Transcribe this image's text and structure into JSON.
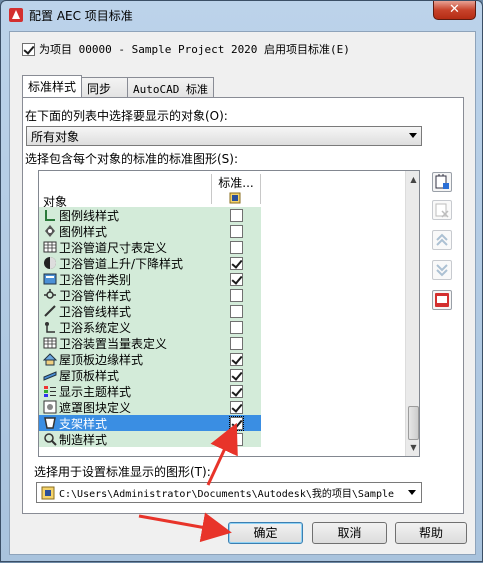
{
  "window": {
    "title": "配置 AEC 项目标准",
    "close": "✕"
  },
  "enable_checkbox": {
    "checked": true,
    "label": "为项目 00000 - Sample Project 2020 启用项目标准(E)"
  },
  "tabs": [
    {
      "label": "标准样式",
      "active": true
    },
    {
      "label": "同步",
      "active": false
    },
    {
      "label": "AutoCAD 标准",
      "active": false
    }
  ],
  "object_list_label": "在下面的列表中选择要显示的对象(O):",
  "object_combo_value": "所有对象",
  "standards_label": "选择包含每个对象的标准的标准图形(S):",
  "list": {
    "col_object": "对象",
    "col_standard": "标准...",
    "rows": [
      {
        "label": "图例线样式",
        "checked": false,
        "icon": "legend-line-icon"
      },
      {
        "label": "图例样式",
        "checked": false,
        "icon": "legend-style-icon"
      },
      {
        "label": "卫浴管道尺寸表定义",
        "checked": false,
        "icon": "table-icon"
      },
      {
        "label": "卫浴管道上升/下降样式",
        "checked": true,
        "icon": "rise-drop-icon"
      },
      {
        "label": "卫浴管件类别",
        "checked": true,
        "icon": "category-icon"
      },
      {
        "label": "卫浴管件样式",
        "checked": false,
        "icon": "fitting-icon"
      },
      {
        "label": "卫浴管线样式",
        "checked": false,
        "icon": "pipe-line-icon"
      },
      {
        "label": "卫浴系统定义",
        "checked": false,
        "icon": "system-icon"
      },
      {
        "label": "卫浴装置当量表定义",
        "checked": false,
        "icon": "table-icon"
      },
      {
        "label": "屋顶板边缘样式",
        "checked": true,
        "icon": "roof-edge-icon"
      },
      {
        "label": "屋顶板样式",
        "checked": true,
        "icon": "roof-slab-icon"
      },
      {
        "label": "显示主题样式",
        "checked": true,
        "icon": "display-theme-icon"
      },
      {
        "label": "遮罩图块定义",
        "checked": true,
        "icon": "mask-block-icon"
      },
      {
        "label": "支架样式",
        "checked": true,
        "icon": "bracket-icon",
        "selected": true
      },
      {
        "label": "制造样式",
        "checked": false,
        "icon": "fabrication-icon"
      }
    ],
    "scroll_position": 0.85
  },
  "display_drawing_label": "选择用于设置标准显示的图形(T):",
  "display_drawing_value": "C:\\Users\\Administrator\\Documents\\Autodesk\\我的项目\\Sample",
  "buttons": {
    "ok": "确定",
    "cancel": "取消",
    "help": "帮助"
  },
  "colors": {
    "row_green": "#d3ebd9",
    "selected": "#3a8ee3",
    "annotation_arrow": "#e8342a"
  }
}
